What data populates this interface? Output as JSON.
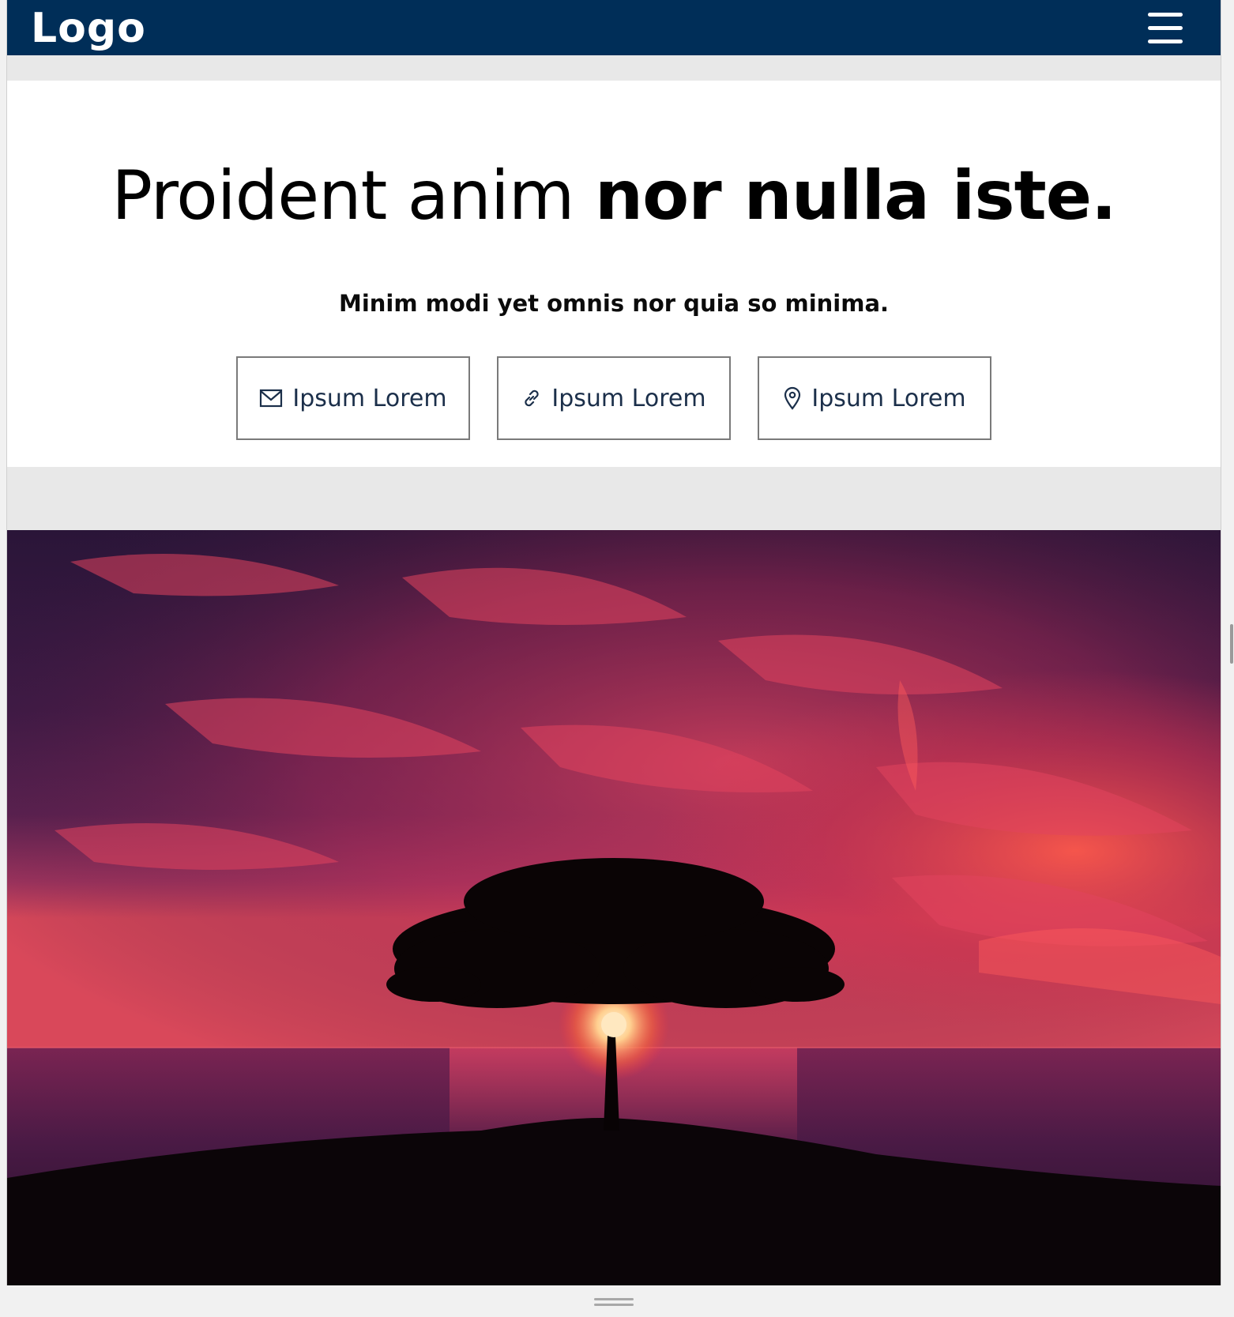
{
  "header": {
    "logo": "Logo",
    "menu_icon": "hamburger-menu-icon",
    "background_color": "#002e58"
  },
  "hero": {
    "title_light": "Proident anim ",
    "title_bold": "nor nulla iste.",
    "subtitle": "Minim modi yet omnis nor quia so minima.",
    "buttons": [
      {
        "label": "Ipsum Lorem",
        "icon": "envelope-icon"
      },
      {
        "label": "Ipsum Lorem",
        "icon": "link-icon"
      },
      {
        "label": "Ipsum Lorem",
        "icon": "map-pin-icon"
      }
    ]
  },
  "image": {
    "subject": "tree-at-sunset-photo"
  },
  "colors": {
    "brand_navy": "#002e58",
    "button_text": "#1b2f4a",
    "page_gray": "#e8e8e8"
  }
}
